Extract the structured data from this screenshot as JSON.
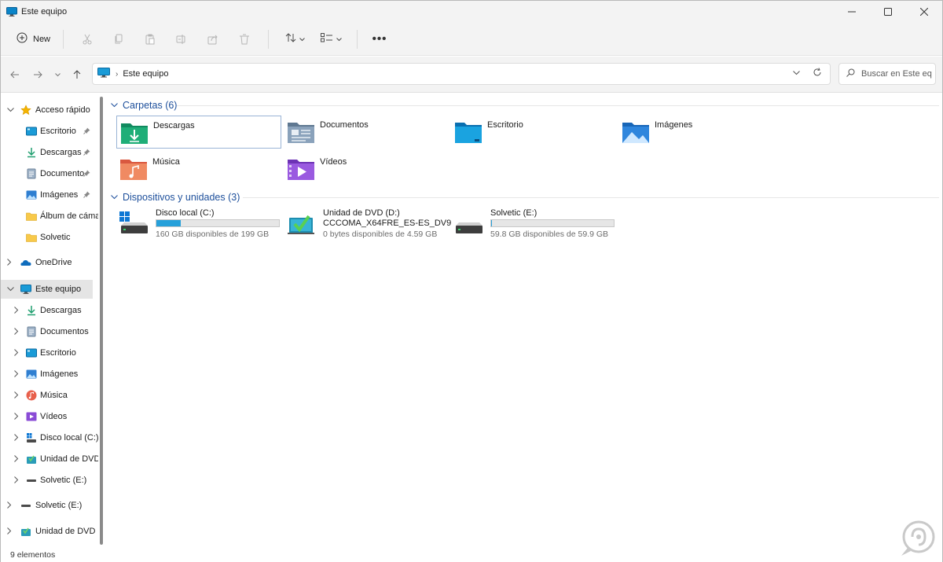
{
  "window": {
    "title": "Este equipo",
    "controls": {
      "minimize": "─",
      "maximize": "☐",
      "close": "✕"
    }
  },
  "commandbar": {
    "new_label": "New",
    "more_label": "•••",
    "icons": [
      "cut-icon",
      "copy-icon",
      "paste-icon",
      "rename-icon",
      "share-icon",
      "delete-icon",
      "sort-icon",
      "view-icon"
    ]
  },
  "address": {
    "crumb": "Este equipo",
    "separator": "›",
    "search_placeholder": "Buscar en Este eq..."
  },
  "sidebar": {
    "quick_access": {
      "label": "Acceso rápido",
      "items": [
        {
          "label": "Escritorio",
          "icon": "desktop-icon",
          "pinned": true
        },
        {
          "label": "Descargas",
          "icon": "download-icon",
          "pinned": true
        },
        {
          "label": "Documento",
          "icon": "documents-icon",
          "pinned": true
        },
        {
          "label": "Imágenes",
          "icon": "pictures-icon",
          "pinned": true
        },
        {
          "label": "Álbum de cáma",
          "icon": "folder-icon",
          "pinned": false
        },
        {
          "label": "Solvetic",
          "icon": "folder-icon",
          "pinned": false
        }
      ]
    },
    "onedrive": {
      "label": "OneDrive"
    },
    "this_pc": {
      "label": "Este equipo",
      "items": [
        {
          "label": "Descargas",
          "icon": "download-icon"
        },
        {
          "label": "Documentos",
          "icon": "documents-icon"
        },
        {
          "label": "Escritorio",
          "icon": "desktop-icon"
        },
        {
          "label": "Imágenes",
          "icon": "pictures-icon"
        },
        {
          "label": "Música",
          "icon": "music-icon"
        },
        {
          "label": "Vídeos",
          "icon": "videos-icon"
        },
        {
          "label": "Disco local (C:)",
          "icon": "local-disk-icon"
        },
        {
          "label": "Unidad de DVD",
          "icon": "dvd-icon"
        },
        {
          "label": "Solvetic (E:)",
          "icon": "drive-icon"
        }
      ]
    },
    "solvetic_drive": {
      "label": "Solvetic (E:)"
    },
    "dvd_drive": {
      "label": "Unidad de DVD ("
    }
  },
  "main": {
    "folders_header": "Carpetas (6)",
    "folders": [
      {
        "label": "Descargas",
        "icon": "downloads-folder-icon"
      },
      {
        "label": "Documentos",
        "icon": "documents-folder-icon"
      },
      {
        "label": "Escritorio",
        "icon": "desktop-folder-icon"
      },
      {
        "label": "Imágenes",
        "icon": "pictures-folder-icon"
      },
      {
        "label": "Música",
        "icon": "music-folder-icon"
      },
      {
        "label": "Vídeos",
        "icon": "videos-folder-icon"
      }
    ],
    "devices_header": "Dispositivos y unidades (3)",
    "drives": [
      {
        "name": "Disco local (C:)",
        "free": "160 GB disponibles de 199 GB",
        "used_fraction": 0.196,
        "icon": "local-disk-icon"
      },
      {
        "name": "Unidad de DVD (D:)",
        "sub": "CCCOMA_X64FRE_ES-ES_DV9",
        "free": "0 bytes disponibles de 4.59 GB",
        "icon": "dvd-drive-icon"
      },
      {
        "name": "Solvetic (E:)",
        "free": "59.8 GB disponibles de 59.9 GB",
        "used_fraction": 0.002,
        "icon": "usb-drive-icon"
      }
    ]
  },
  "status": {
    "count": "9 elementos"
  },
  "colors": {
    "accent": "#26a0da",
    "group_header": "#1d4f9b",
    "selection": "#e5e5e5"
  }
}
